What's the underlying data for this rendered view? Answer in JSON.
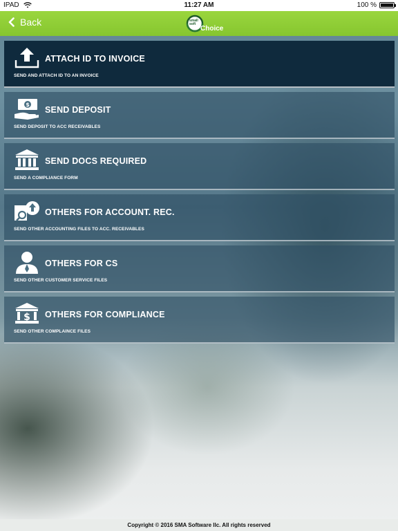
{
  "status_bar": {
    "device": "IPAD",
    "time": "11:27 AM",
    "battery": "100 %",
    "battery_level": 1.0
  },
  "nav": {
    "back_label": "Back",
    "logo_text": "Choice",
    "logo_small": "small\nsoft"
  },
  "menu": {
    "items": [
      {
        "title": "ATTACH ID TO INVOICE",
        "subtitle": "SEND AND ATTACH ID TO AN INVOICE",
        "icon": "upload-icon"
      },
      {
        "title": "SEND DEPOSIT",
        "subtitle": "SEND DEPOSIT TO ACC RECEIVABLES",
        "icon": "cash-hand-icon"
      },
      {
        "title": "SEND DOCS REQUIRED",
        "subtitle": "SEND A COMPLIANCE FORM",
        "icon": "bank-icon"
      },
      {
        "title": "OTHERS FOR ACCOUNT. REC.",
        "subtitle": "SEND OTHER ACCOUNTING FILES TO ACC. RECEIVABLES",
        "icon": "search-upload-icon"
      },
      {
        "title": "OTHERS FOR CS",
        "subtitle": "SEND OTHER CUSTOMER SERVICE FILES",
        "icon": "user-icon"
      },
      {
        "title": "OTHERS FOR COMPLIANCE",
        "subtitle": "SEND OTHER COMPLAINCE FILES",
        "icon": "bank-dollar-icon"
      }
    ]
  },
  "footer": {
    "copyright": "Copyright © 2016 SMA Software llc. All rights reserved"
  }
}
